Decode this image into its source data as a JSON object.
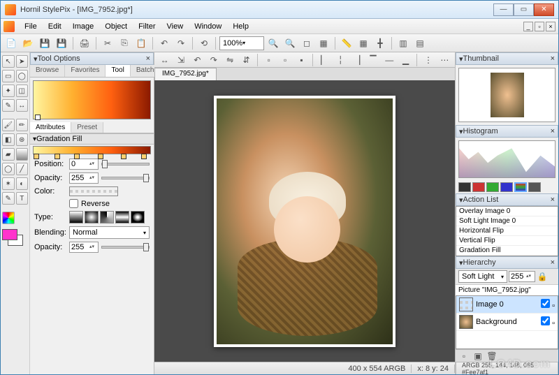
{
  "window": {
    "title": "Hornil StylePix - [IMG_7952.jpg*]"
  },
  "menu": {
    "file": "File",
    "edit": "Edit",
    "image": "Image",
    "object": "Object",
    "filter": "Filter",
    "view": "View",
    "window": "Window",
    "help": "Help"
  },
  "toolbar": {
    "zoom": "100%"
  },
  "tool_options": {
    "title": "Tool Options",
    "tabs": {
      "browse": "Browse",
      "favorites": "Favorites",
      "tool": "Tool",
      "batch": "Batch"
    },
    "attributes": "Attributes",
    "preset": "Preset",
    "section": "Gradation Fill",
    "position_label": "Position:",
    "position_value": "0",
    "opacity_label": "Opacity:",
    "opacity_value": "255",
    "color_label": "Color:",
    "reverse_label": "Reverse",
    "type_label": "Type:",
    "blending_label": "Blending:",
    "blending_value": "Normal",
    "opacity2_label": "Opacity:",
    "opacity2_value": "255"
  },
  "canvas": {
    "tab": "IMG_7952.jpg*",
    "status_dims": "400 x 554 ARGB",
    "status_pos": "x: 8 y: 24",
    "status_right": "ARGB 255, 144, 148, 065 #Fee7af1"
  },
  "thumbnail_panel": {
    "title": "Thumbnail"
  },
  "histogram_panel": {
    "title": "Histogram"
  },
  "action_list": {
    "title": "Action List",
    "items": [
      "Overlay Image 0",
      "Soft Light Image 0",
      "Horizontal Flip",
      "Vertical Flip",
      "Gradation Fill"
    ]
  },
  "hierarchy": {
    "title": "Hierarchy",
    "blend_mode": "Soft Light",
    "opacity": "255",
    "picture_label": "Picture \"IMG_7952.jpg\"",
    "layers": [
      {
        "name": "Image 0",
        "selected": true
      },
      {
        "name": "Background",
        "selected": false
      }
    ]
  },
  "watermark": "LO4D.com"
}
